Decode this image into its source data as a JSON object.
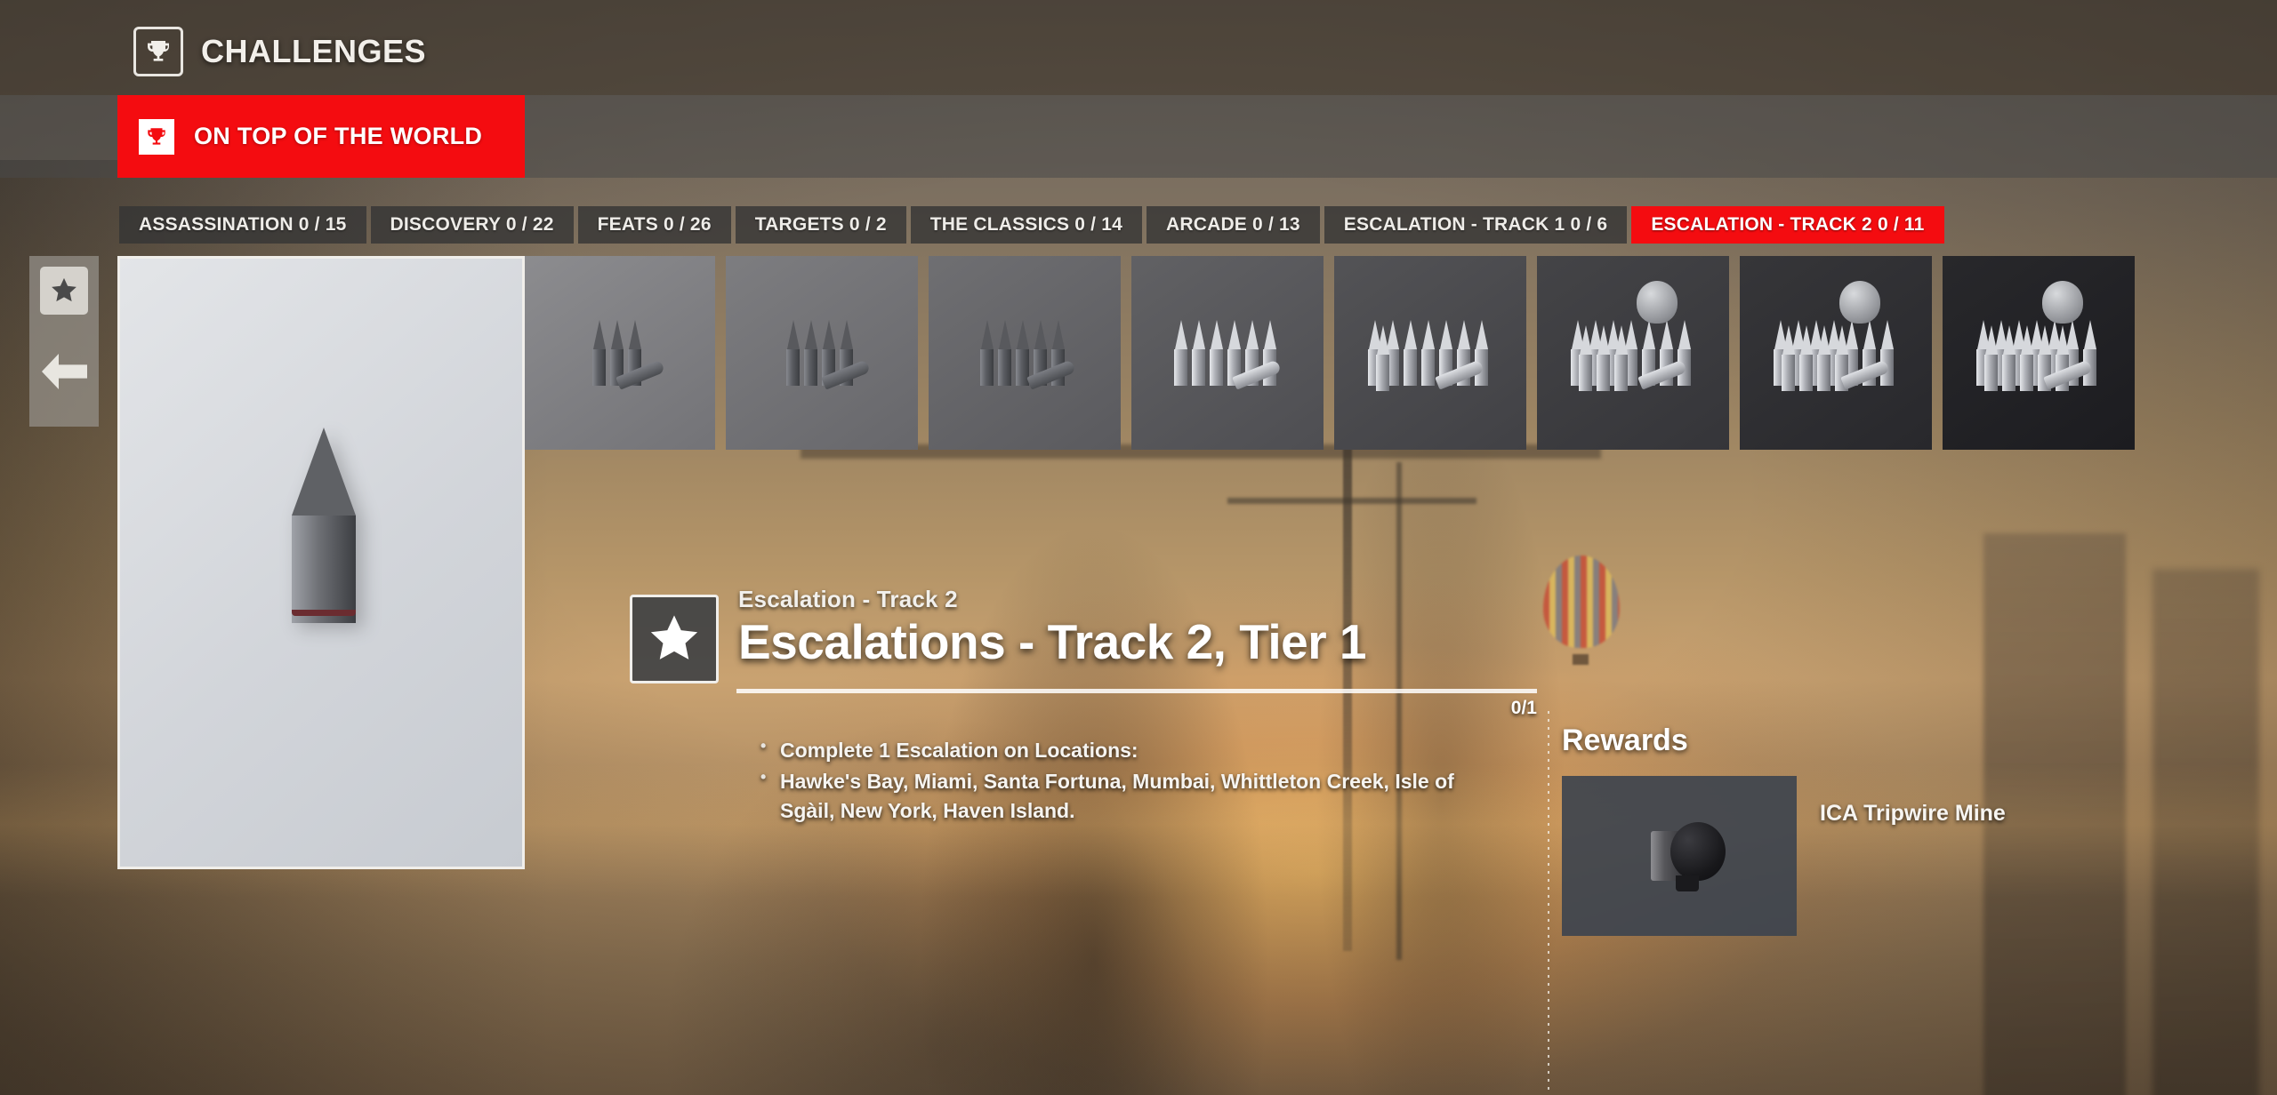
{
  "header": {
    "title": "CHALLENGES",
    "icon": "trophy-icon"
  },
  "challenge_banner": {
    "label": "ON TOP OF THE WORLD",
    "icon": "trophy-icon",
    "color": "#f40c10"
  },
  "tabs": [
    {
      "label": "ASSASSINATION 0 / 15",
      "name": "tab-assassination",
      "active": false
    },
    {
      "label": "DISCOVERY 0 / 22",
      "name": "tab-discovery",
      "active": false
    },
    {
      "label": "FEATS 0 / 26",
      "name": "tab-feats",
      "active": false
    },
    {
      "label": "TARGETS 0 / 2",
      "name": "tab-targets",
      "active": false
    },
    {
      "label": "THE CLASSICS 0 / 14",
      "name": "tab-the-classics",
      "active": false
    },
    {
      "label": "ARCADE 0 / 13",
      "name": "tab-arcade",
      "active": false
    },
    {
      "label": "ESCALATION - TRACK 1 0 / 6",
      "name": "tab-escalation-track-1",
      "active": false
    },
    {
      "label": "ESCALATION - TRACK 2 0 / 11",
      "name": "tab-escalation-track-2",
      "active": true
    }
  ],
  "rail": {
    "star_icon": "star-icon",
    "back_icon": "arrow-left-icon"
  },
  "detail": {
    "kicker": "Escalation - Track 2",
    "title": "Escalations - Track 2, Tier 1",
    "badge_icon": "star-icon",
    "progress_label": "0/1",
    "progress_percent": 0,
    "objectives": [
      "Complete 1 Escalation on Locations:",
      "Hawke's Bay, Miami, Santa Fortuna, Mumbai, Whittleton Creek, Isle of Sgàil, New York, Haven Island."
    ]
  },
  "rewards": {
    "title": "Rewards",
    "items": [
      {
        "name": "ICA Tripwire Mine",
        "icon": "tripwire-mine-icon"
      }
    ]
  },
  "thumbnails": [
    {
      "name": "challenge-thumb-tier-1",
      "bullets": 1,
      "selected": true
    },
    {
      "name": "challenge-thumb-tier-2",
      "bullets": 2,
      "selected": false
    },
    {
      "name": "challenge-thumb-tier-3",
      "bullets": 3,
      "selected": false
    },
    {
      "name": "challenge-thumb-tier-4",
      "bullets": 4,
      "selected": false
    },
    {
      "name": "challenge-thumb-tier-5",
      "bullets": 5,
      "selected": false
    },
    {
      "name": "challenge-thumb-tier-6",
      "bullets": 6,
      "selected": false
    },
    {
      "name": "challenge-thumb-tier-7",
      "bullets": 8,
      "selected": false
    },
    {
      "name": "challenge-thumb-tier-8",
      "bullets": 10,
      "selected": false
    },
    {
      "name": "challenge-thumb-tier-9",
      "bullets": 11,
      "selected": false
    },
    {
      "name": "challenge-thumb-tier-10",
      "bullets": 12,
      "selected": false
    }
  ],
  "colors": {
    "accent": "#f40c10",
    "tab_bg": "#343434",
    "text": "#f2efea"
  }
}
